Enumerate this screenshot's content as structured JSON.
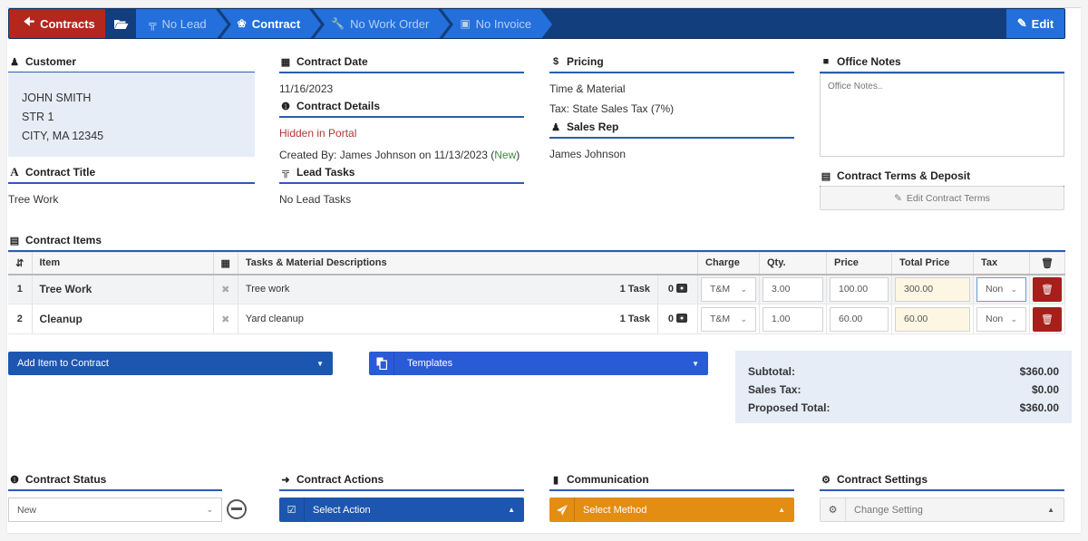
{
  "nav": {
    "back_label": "Contracts",
    "crumbs": [
      {
        "label": "No Lead",
        "icon": "signpost-icon"
      },
      {
        "label": "Contract",
        "icon": "handshake-icon"
      },
      {
        "label": "No Work Order",
        "icon": "wrench-icon"
      },
      {
        "label": "No Invoice",
        "icon": "money-icon"
      }
    ],
    "edit_label": "Edit"
  },
  "customer": {
    "heading": "Customer",
    "name": "JOHN SMITH",
    "street": "STR 1",
    "city": "CITY, MA 12345"
  },
  "contract_title": {
    "heading": "Contract Title",
    "value": "Tree Work"
  },
  "contract_date": {
    "heading": "Contract Date",
    "value": "11/16/2023"
  },
  "contract_details": {
    "heading": "Contract Details",
    "portal_status": "Hidden in Portal",
    "created_prefix": "Created By: James Johnson on 11/13/2023 (",
    "created_status": "New",
    "created_suffix": ")"
  },
  "lead_tasks": {
    "heading": "Lead Tasks",
    "value": "No Lead Tasks"
  },
  "pricing": {
    "heading": "Pricing",
    "type": "Time & Material",
    "tax": "Tax: State Sales Tax (7%)"
  },
  "sales_rep": {
    "heading": "Sales Rep",
    "value": "James Johnson"
  },
  "office_notes": {
    "heading": "Office Notes",
    "placeholder": "Office Notes..",
    "value": ""
  },
  "contract_terms": {
    "heading": "Contract Terms & Deposit",
    "button_label": "Edit Contract Terms"
  },
  "contract_items": {
    "heading": "Contract Items",
    "columns": {
      "item": "Item",
      "descriptions": "Tasks & Material Descriptions",
      "charge": "Charge",
      "qty": "Qty.",
      "price": "Price",
      "total_price": "Total Price",
      "tax": "Tax"
    },
    "rows": [
      {
        "num": "1",
        "name": "Tree Work",
        "description": "Tree work",
        "tasks": "1 Task",
        "photos": "0",
        "charge": "T&M",
        "qty": "3.00",
        "price": "100.00",
        "total": "300.00",
        "tax": "Non"
      },
      {
        "num": "2",
        "name": "Cleanup",
        "description": "Yard cleanup",
        "tasks": "1 Task",
        "photos": "0",
        "charge": "T&M",
        "qty": "1.00",
        "price": "60.00",
        "total": "60.00",
        "tax": "Non"
      }
    ]
  },
  "add_item": {
    "label": "Add Item to Contract"
  },
  "templates": {
    "label": "Templates"
  },
  "totals": {
    "subtotal_label": "Subtotal:",
    "subtotal": "$360.00",
    "sales_tax_label": "Sales Tax:",
    "sales_tax": "$0.00",
    "proposed_label": "Proposed Total:",
    "proposed": "$360.00"
  },
  "contract_status": {
    "heading": "Contract Status",
    "value": "New"
  },
  "contract_actions": {
    "heading": "Contract Actions",
    "label": "Select Action"
  },
  "communication": {
    "heading": "Communication",
    "label": "Select Method"
  },
  "contract_settings": {
    "heading": "Contract Settings",
    "label": "Change Setting"
  },
  "colors": {
    "nav_dark": "#133e7e",
    "nav_blue": "#2370dd",
    "back_red": "#b3271f",
    "heading_rule": "#2a5db0",
    "danger": "#a5201b",
    "communication_orange": "#e38d13",
    "templates_blue": "#2a5bd7",
    "primary_blue": "#1d56b0",
    "portal_hidden": "#b0383a",
    "status_new": "#3c8d3c"
  }
}
